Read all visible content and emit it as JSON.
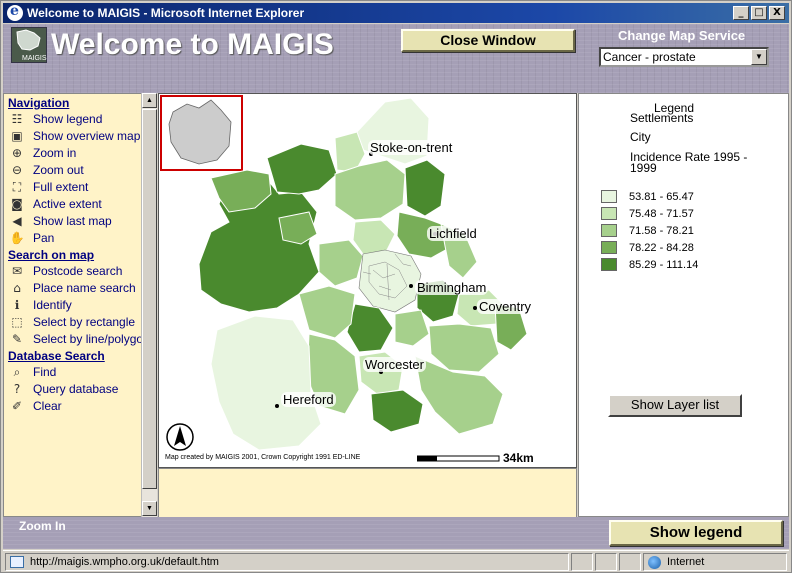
{
  "window": {
    "title": "Welcome to MAIGIS - Microsoft Internet Explorer",
    "min": "_",
    "max": "□",
    "close": "X"
  },
  "header": {
    "logo_text": "MAIGIS",
    "app_title": "Welcome to MAIGIS",
    "close_window": "Close Window",
    "change_map_label": "Change Map Service",
    "map_service": "Cancer - prostate"
  },
  "nav": {
    "navigation_heading": "Navigation",
    "navigation": [
      {
        "label": "Show legend",
        "icon": "legend-icon"
      },
      {
        "label": "Show overview map",
        "icon": "overview-map-icon"
      },
      {
        "label": "Zoom in",
        "icon": "zoom-in-icon"
      },
      {
        "label": "Zoom out",
        "icon": "zoom-out-icon"
      },
      {
        "label": "Full extent",
        "icon": "full-extent-icon"
      },
      {
        "label": "Active extent",
        "icon": "active-extent-icon"
      },
      {
        "label": "Show last map",
        "icon": "last-map-icon"
      },
      {
        "label": "Pan",
        "icon": "pan-hand-icon"
      }
    ],
    "search_heading": "Search on map",
    "search": [
      {
        "label": "Postcode search",
        "icon": "postcode-icon"
      },
      {
        "label": "Place name search",
        "icon": "placename-icon"
      },
      {
        "label": "Identify",
        "icon": "identify-icon"
      },
      {
        "label": "Select by rectangle",
        "icon": "select-rectangle-icon"
      },
      {
        "label": "Select by line/polygon",
        "icon": "select-polygon-icon"
      }
    ],
    "db_heading": "Database Search",
    "db": [
      {
        "label": "Find",
        "icon": "find-icon"
      },
      {
        "label": "Query database",
        "icon": "query-icon"
      },
      {
        "label": "Clear",
        "icon": "clear-icon"
      }
    ]
  },
  "map": {
    "labels": [
      "Stoke-on-trent",
      "Lichfield",
      "Birmingham",
      "Coventry",
      "Worcester",
      "Hereford"
    ],
    "credit": "Map created by MAIGIS 2001, Crown Copyright 1991 ED-LINE",
    "scale": "34km"
  },
  "legend": {
    "title": "Legend",
    "settlements": "Settlements",
    "city": "City",
    "rate_title": "Incidence Rate 1995 - 1999",
    "classes": [
      {
        "range": "53.81 - 65.47",
        "color": "#e8f5e0"
      },
      {
        "range": "75.48 - 71.57",
        "color": "#c8e6b4"
      },
      {
        "range": "71.58 - 78.21",
        "color": "#a6d08c"
      },
      {
        "range": "78.22 - 84.28",
        "color": "#78ae58"
      },
      {
        "range": "85.29 - 111.14",
        "color": "#4a8a2e"
      }
    ],
    "layer_list_button": "Show Layer list"
  },
  "bottom": {
    "zoom_in": "Zoom In",
    "show_legend": "Show legend"
  },
  "status": {
    "url": "http://maigis.wmpho.org.uk/default.htm",
    "zone": "Internet"
  }
}
